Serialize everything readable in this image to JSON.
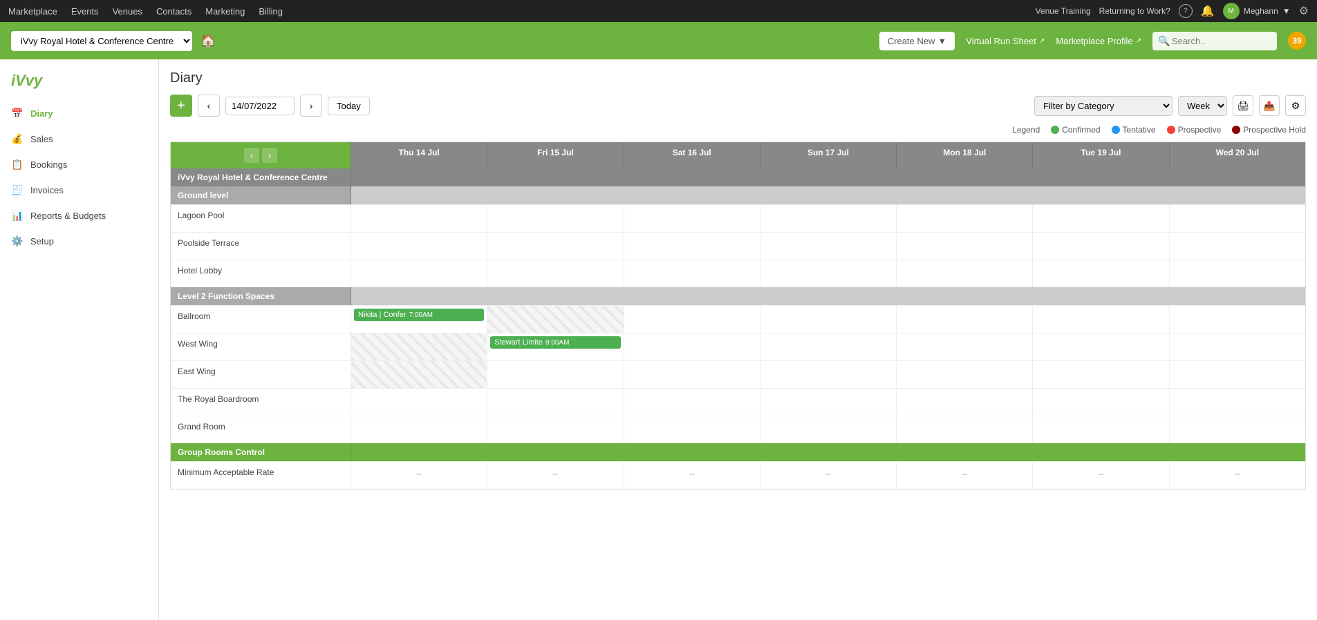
{
  "topNav": {
    "items": [
      "Marketplace",
      "Events",
      "Venues",
      "Contacts",
      "Marketing",
      "Billing"
    ],
    "right": {
      "venueTraining": "Venue Training",
      "returningToWork": "Returning to Work?",
      "user": "Meghann"
    }
  },
  "venueBar": {
    "venueName": "iVvy Royal Hotel & Conference Centre",
    "createNew": "Create New",
    "virtualRunSheet": "Virtual Run Sheet",
    "marketplaceProfile": "Marketplace Profile",
    "searchPlaceholder": "Search..",
    "notificationCount": "39"
  },
  "sidebar": {
    "logo": "iVvy",
    "items": [
      {
        "label": "Diary",
        "active": true,
        "icon": "📅"
      },
      {
        "label": "Sales",
        "active": false,
        "icon": "💰"
      },
      {
        "label": "Bookings",
        "active": false,
        "icon": "📋"
      },
      {
        "label": "Invoices",
        "active": false,
        "icon": "🧾"
      },
      {
        "label": "Reports & Budgets",
        "active": false,
        "icon": "📊"
      },
      {
        "label": "Setup",
        "active": false,
        "icon": "⚙️"
      }
    ]
  },
  "diary": {
    "title": "Diary",
    "currentDate": "14/07/2022",
    "filterByCategory": "Filter by Category",
    "viewMode": "Week",
    "todayBtn": "Today",
    "legend": {
      "label": "Legend",
      "items": [
        {
          "label": "Confirmed",
          "color": "#4caf50"
        },
        {
          "label": "Tentative",
          "color": "#2196f3"
        },
        {
          "label": "Prospective",
          "color": "#f44336"
        },
        {
          "label": "Prospective Hold",
          "color": "#8b0000"
        }
      ]
    },
    "days": [
      {
        "label": "Thu 14 Jul"
      },
      {
        "label": "Fri 15 Jul"
      },
      {
        "label": "Sat 16 Jul"
      },
      {
        "label": "Sun 17 Jul"
      },
      {
        "label": "Mon 18 Jul"
      },
      {
        "label": "Tue 19 Jul"
      },
      {
        "label": "Wed 20 Jul"
      }
    ],
    "venueSection": {
      "name": "iVvy Royal Hotel & Conference Centre",
      "sections": [
        {
          "name": "Ground level",
          "rooms": [
            {
              "name": "Lagoon Pool",
              "events": []
            },
            {
              "name": "Poolside Terrace",
              "events": []
            },
            {
              "name": "Hotel Lobby",
              "events": []
            }
          ]
        },
        {
          "name": "Level 2 Function Spaces",
          "rooms": [
            {
              "name": "Ballroom",
              "events": [
                {
                  "dayIndex": 0,
                  "label": "Nikita | Confer",
                  "time": "7:00AM",
                  "type": "confirmed"
                },
                {
                  "dayIndex": 1,
                  "label": "",
                  "type": "striped"
                }
              ]
            },
            {
              "name": "West Wing",
              "events": [
                {
                  "dayIndex": 0,
                  "label": "",
                  "type": "striped"
                },
                {
                  "dayIndex": 1,
                  "label": "Stewart Limite",
                  "time": "9:00AM",
                  "type": "confirmed"
                }
              ]
            },
            {
              "name": "East Wing",
              "events": [
                {
                  "dayIndex": 0,
                  "label": "",
                  "type": "striped"
                }
              ]
            },
            {
              "name": "The Royal Boardroom",
              "events": []
            },
            {
              "name": "Grand Room",
              "events": []
            }
          ]
        },
        {
          "name": "Group Rooms Control",
          "isGroup": true,
          "rooms": [
            {
              "name": "Minimum Acceptable Rate",
              "dashes": [
                "--",
                "--",
                "--",
                "--",
                "--",
                "--",
                "--"
              ]
            }
          ]
        }
      ]
    }
  }
}
